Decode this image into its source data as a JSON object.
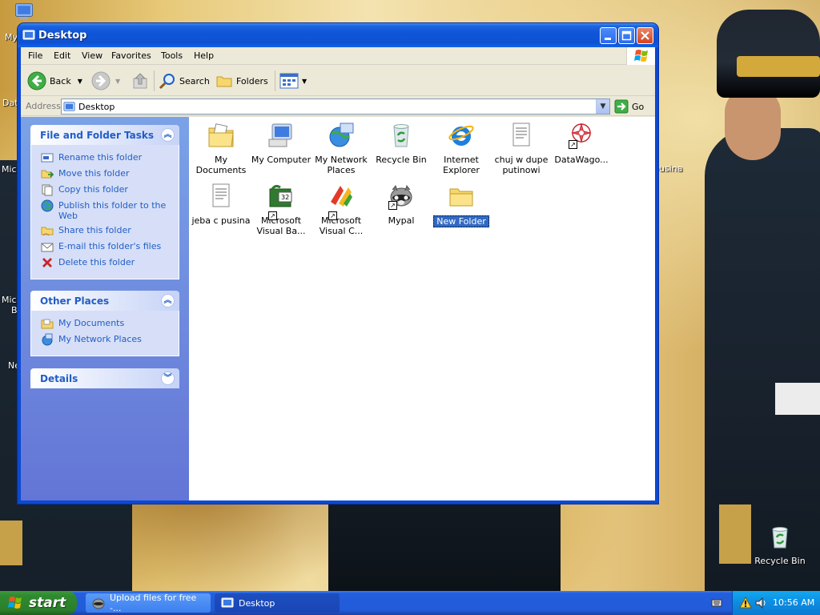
{
  "window": {
    "title": "Desktop",
    "menu": [
      "File",
      "Edit",
      "View",
      "Favorites",
      "Tools",
      "Help"
    ],
    "toolbar": {
      "back": "Back",
      "search": "Search",
      "folders": "Folders"
    },
    "address": {
      "label": "Address",
      "value": "Desktop",
      "go": "Go"
    }
  },
  "taskpane": {
    "file_tasks": {
      "title": "File and Folder Tasks",
      "items": [
        {
          "label": "Rename this folder",
          "icon": "rename-icon"
        },
        {
          "label": "Move this folder",
          "icon": "move-icon"
        },
        {
          "label": "Copy this folder",
          "icon": "copy-icon"
        },
        {
          "label": "Publish this folder to the Web",
          "icon": "publish-web-icon"
        },
        {
          "label": "Share this folder",
          "icon": "share-icon"
        },
        {
          "label": "E-mail this folder's files",
          "icon": "email-icon"
        },
        {
          "label": "Delete this folder",
          "icon": "delete-icon"
        }
      ]
    },
    "other_places": {
      "title": "Other Places",
      "items": [
        {
          "label": "My Documents",
          "icon": "my-documents-icon"
        },
        {
          "label": "My Network Places",
          "icon": "network-places-icon"
        }
      ]
    },
    "details": {
      "title": "Details"
    }
  },
  "files": [
    {
      "label": "My Documents"
    },
    {
      "label": "My Computer"
    },
    {
      "label": "My Network Places"
    },
    {
      "label": "Recycle Bin"
    },
    {
      "label": "Internet Explorer"
    },
    {
      "label": "chuj w dupe putinowi"
    },
    {
      "label": "DataWago..."
    },
    {
      "label": "jeba c pusina"
    },
    {
      "label": "Microsoft Visual Ba..."
    },
    {
      "label": "Microsoft Visual C..."
    },
    {
      "label": "Mypal"
    },
    {
      "label": "New Folder",
      "selected": true
    }
  ],
  "desktop": {
    "recycle_bin": "Recycle Bin",
    "partial_labels": [
      "My",
      "Dat",
      "Micr",
      "Micr",
      "B",
      "Ne",
      "pusina"
    ]
  },
  "taskbar": {
    "start": "start",
    "tasks": [
      "Upload files for free -...",
      "Desktop"
    ],
    "clock": "10:56 AM"
  },
  "colors": {
    "title_blue": "#0d52d2",
    "taskpane_link": "#215dc6",
    "selection": "#316ac5",
    "start_green": "#2f8a2f"
  }
}
